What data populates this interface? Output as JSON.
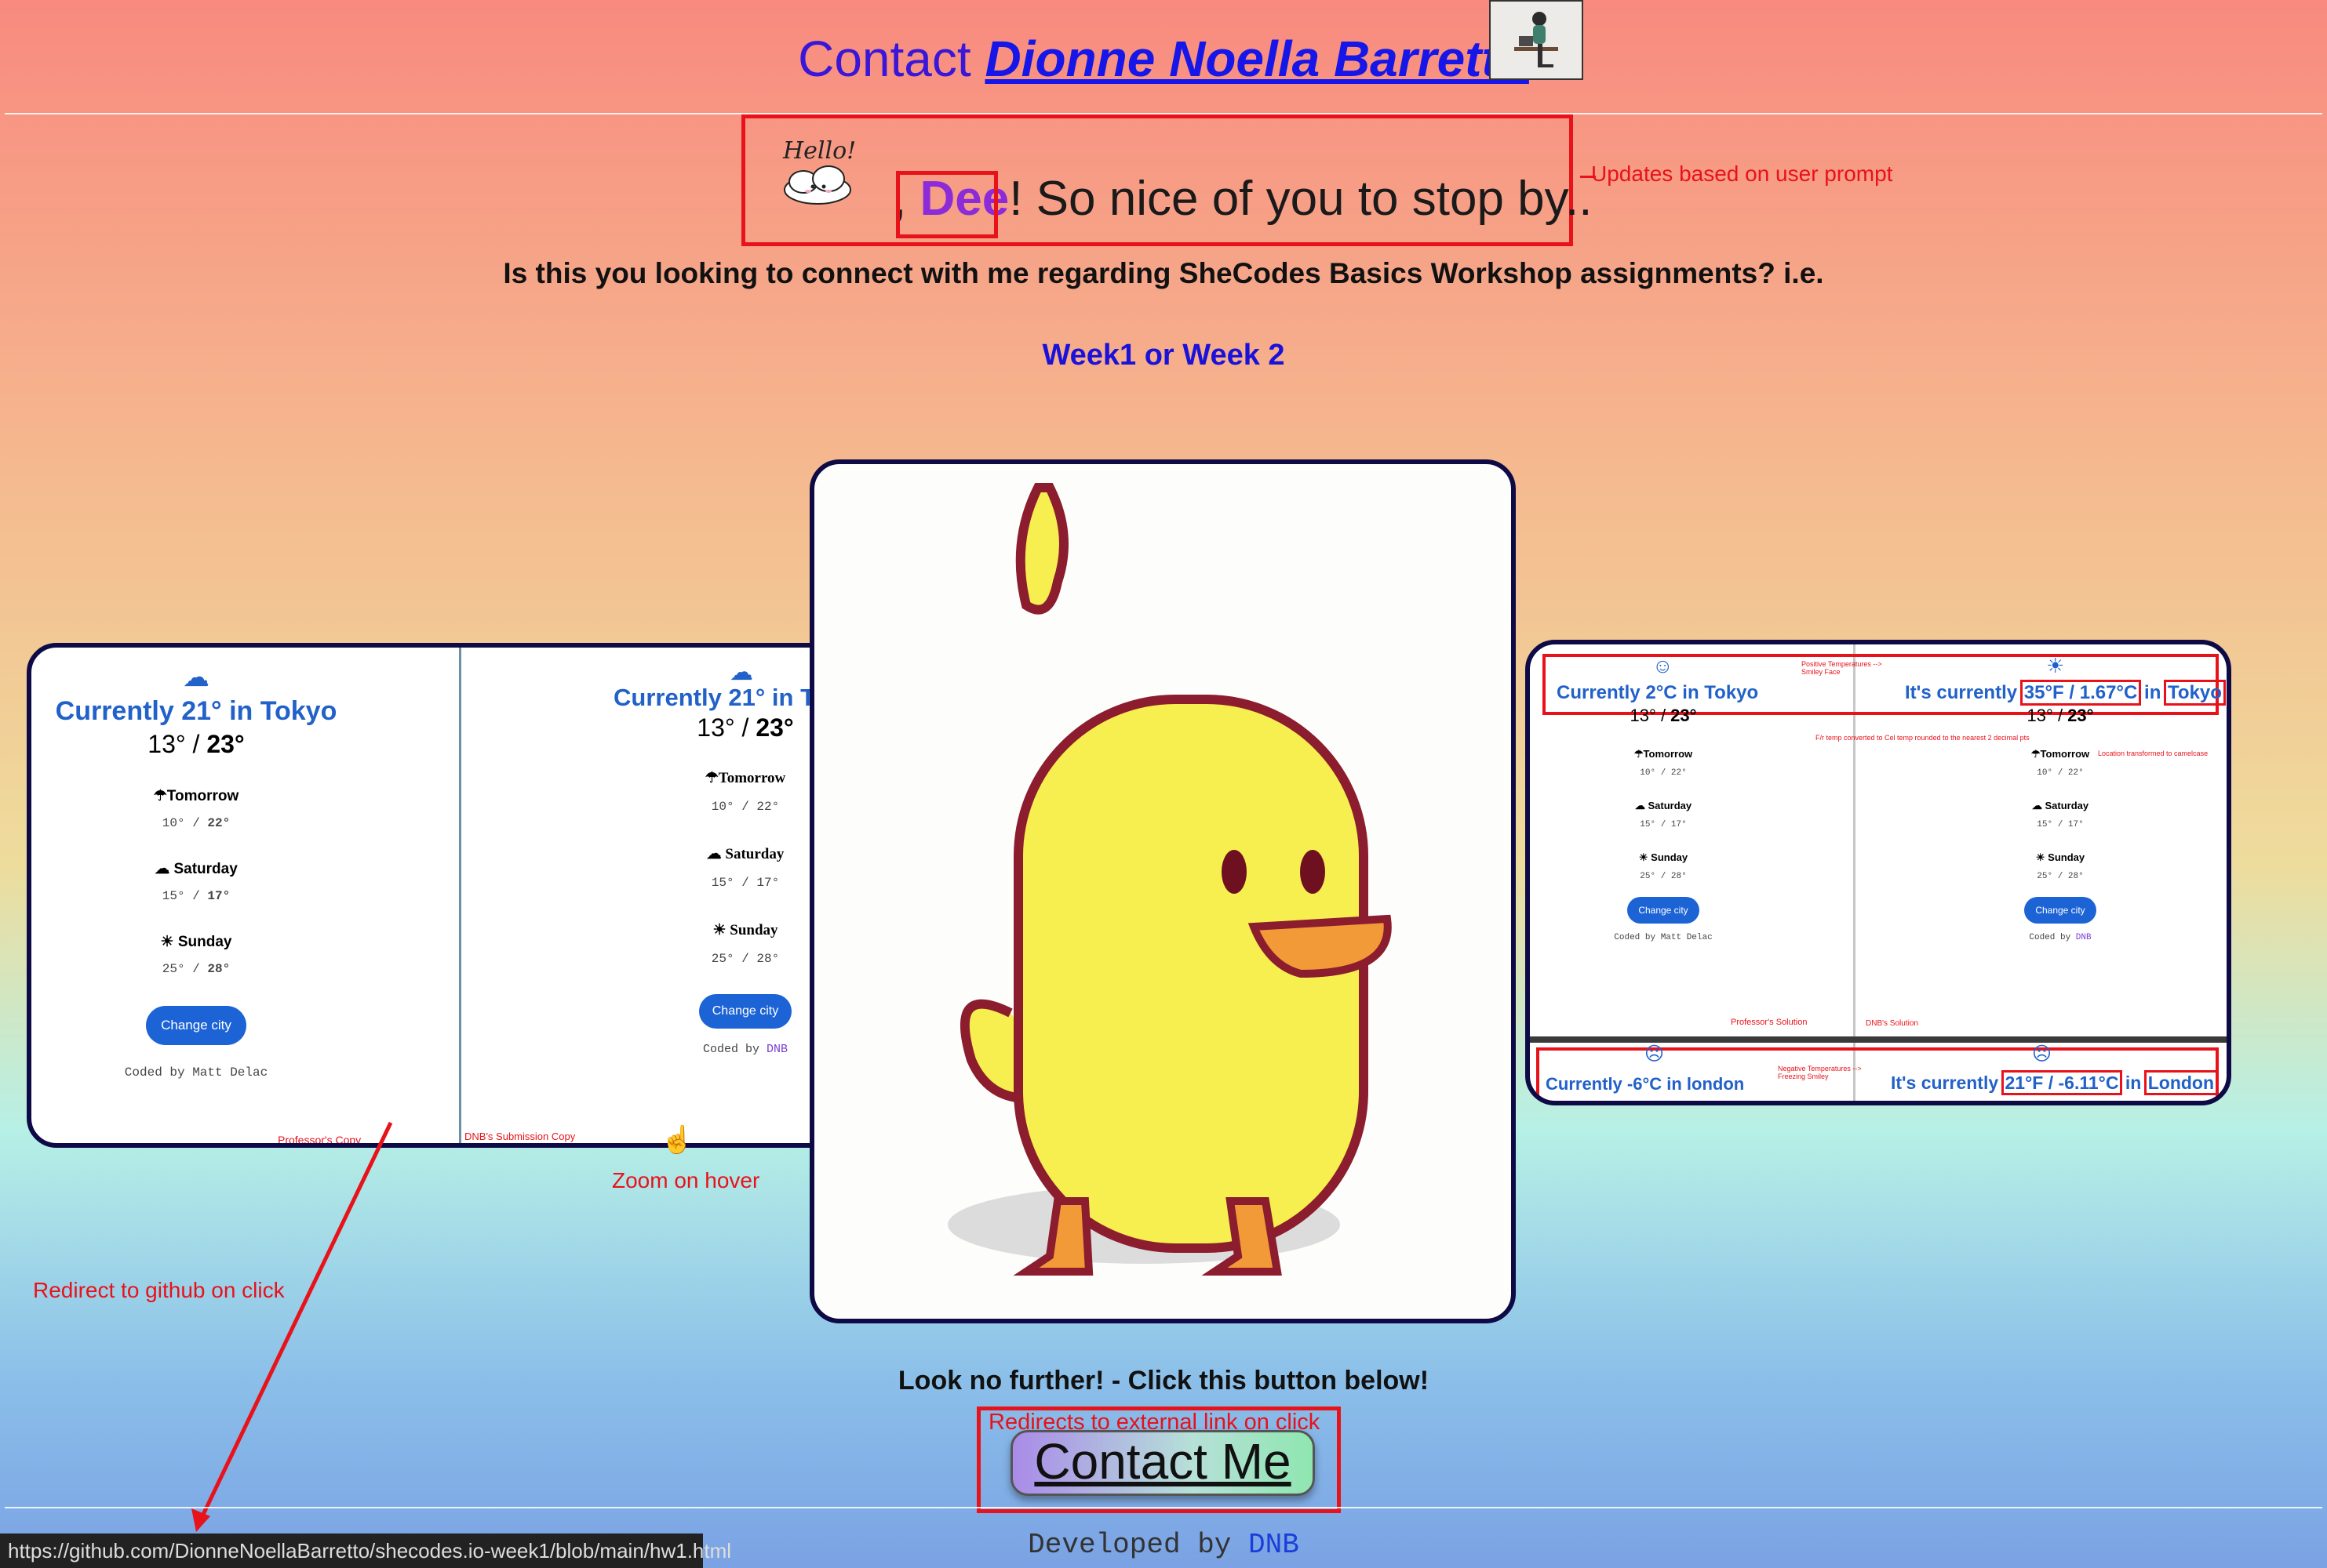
{
  "header": {
    "contact_word": "Contact",
    "name": "Dionne Noella Barretto"
  },
  "greeting": {
    "hello_sticker": "Hello!",
    "prefix": ",",
    "name": "Dee",
    "suffix": "! So nice of you to stop by.."
  },
  "question": "Is this you looking to connect with me regarding SheCodes Basics Workshop assignments? i.e.",
  "week_link": "Week1 or Week 2",
  "annotations": {
    "updates_prompt": "Updates based on user prompt",
    "zoom_hover": "Zoom on hover",
    "redirect_github": "Redirect to github on click",
    "redirect_external": "Redirects to external link on click"
  },
  "left_card": {
    "professor": {
      "title": "Currently 21° in Tokyo",
      "low": "13°",
      "high": "23°",
      "forecast": [
        {
          "day": "Tomorrow",
          "low": "10°",
          "high": "22°",
          "icon": "rain-cloud-icon"
        },
        {
          "day": "Saturday",
          "low": "15°",
          "high": "17°",
          "icon": "cloud-icon"
        },
        {
          "day": "Sunday",
          "low": "25°",
          "high": "28°",
          "icon": "sun-icon"
        }
      ],
      "button": "Change city",
      "coded_by": "Coded by Matt Delac",
      "caption": "Professor's Copy"
    },
    "submission": {
      "title": "Currently 21° in Tokyo",
      "low": "13°",
      "high": "23°",
      "forecast": [
        {
          "day": "Tomorrow",
          "low": "10°",
          "high": "22°"
        },
        {
          "day": "Saturday",
          "low": "15°",
          "high": "17°"
        },
        {
          "day": "Sunday",
          "low": "25°",
          "high": "28°"
        }
      ],
      "button": "Change city",
      "coded_by_prefix": "Coded by",
      "coded_by_link": "DNB",
      "caption": "DNB's Submission Copy"
    }
  },
  "right_card": {
    "prof_title": "Currently 2°C in Tokyo",
    "dnb_title_prefix": "It's currently",
    "dnb_temp": "35°F / 1.67°C",
    "dnb_in": "in",
    "dnb_city": "Tokyo",
    "pos_note": "Positive Temperatures --> Smiley Face",
    "conv_note": "F/r temp converted to Cel temp rounded to the nearest 2 decimal pts",
    "loc_note": "Location transformed to camelcase",
    "low": "13°",
    "high": "23°",
    "forecast": [
      {
        "day": "Tomorrow",
        "low": "10°",
        "high": "22°"
      },
      {
        "day": "Saturday",
        "low": "15°",
        "high": "17°"
      },
      {
        "day": "Sunday",
        "low": "25°",
        "high": "28°"
      }
    ],
    "button": "Change city",
    "prof_coded": "Coded by Matt Delac",
    "dnb_coded_prefix": "Coded by",
    "dnb_coded_link": "DNB",
    "prof_solution": "Professor's Solution",
    "dnb_solution": "DNB's Solution",
    "neg_prof_title": "Currently -6°C in london",
    "neg_dnb_prefix": "It's currently",
    "neg_dnb_temp": "21°F / -6.11°C",
    "neg_dnb_in": "in",
    "neg_dnb_city": "London",
    "neg_note": "Negative Temperatures --> Freezing Smiley"
  },
  "contact": {
    "look_further": "Look no further! - Click this button below!",
    "button": "Contact Me"
  },
  "footer": {
    "developed_by": "Developed by",
    "dev_link": "DNB"
  },
  "status_bar": "https://github.com/DionneNoellaBarretto/shecodes.io-week1/blob/main/hw1.html"
}
